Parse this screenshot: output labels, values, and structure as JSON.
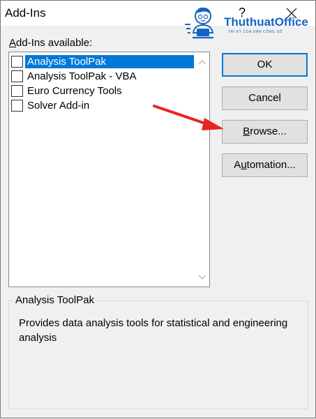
{
  "window": {
    "title": "Add-Ins",
    "help_label": "?"
  },
  "list": {
    "label_prefix": "A",
    "label_rest": "dd-Ins available:",
    "items": [
      {
        "label": "Analysis ToolPak",
        "checked": false,
        "selected": true
      },
      {
        "label": "Analysis ToolPak - VBA",
        "checked": false,
        "selected": false
      },
      {
        "label": "Euro Currency Tools",
        "checked": false,
        "selected": false
      },
      {
        "label": "Solver Add-in",
        "checked": false,
        "selected": false
      }
    ]
  },
  "buttons": {
    "ok": "OK",
    "cancel": "Cancel",
    "browse_accel": "B",
    "browse_rest": "rowse...",
    "automation_prefix": "A",
    "automation_accel": "u",
    "automation_rest": "tomation..."
  },
  "description_group": {
    "title": "Analysis ToolPak",
    "text": "Provides data analysis tools for statistical and engineering analysis"
  },
  "watermark": {
    "name": "ThuthuatOffice",
    "tagline": "TRI KỲ CỦA DÂN CÔNG SỞ"
  },
  "colors": {
    "selection": "#0078d7",
    "annotation_arrow": "#e52521",
    "brand": "#1565c0"
  }
}
